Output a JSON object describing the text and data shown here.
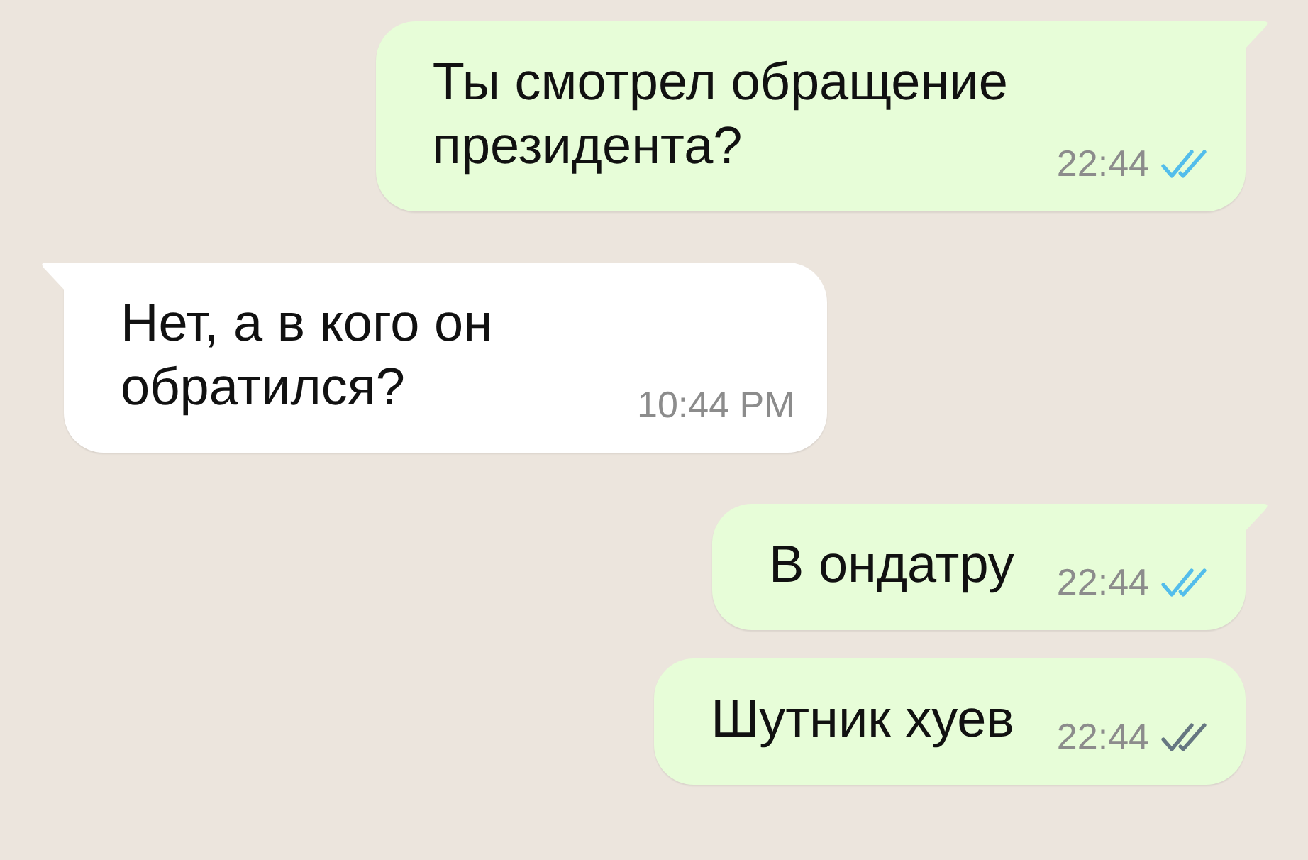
{
  "messages": [
    {
      "kind": "outgoing",
      "tail": true,
      "text": "Ты смотрел обращение президента?",
      "time": "22:44",
      "read": true
    },
    {
      "kind": "incoming",
      "tail": true,
      "text": "Нет, а в кого он обратился?",
      "time": "10:44 PM"
    },
    {
      "kind": "outgoing",
      "tail": true,
      "text": "В ондатру",
      "time": "22:44",
      "read": true
    },
    {
      "kind": "outgoing",
      "tail": false,
      "text": "Шутник хуев",
      "time": "22:44",
      "read": false
    }
  ]
}
